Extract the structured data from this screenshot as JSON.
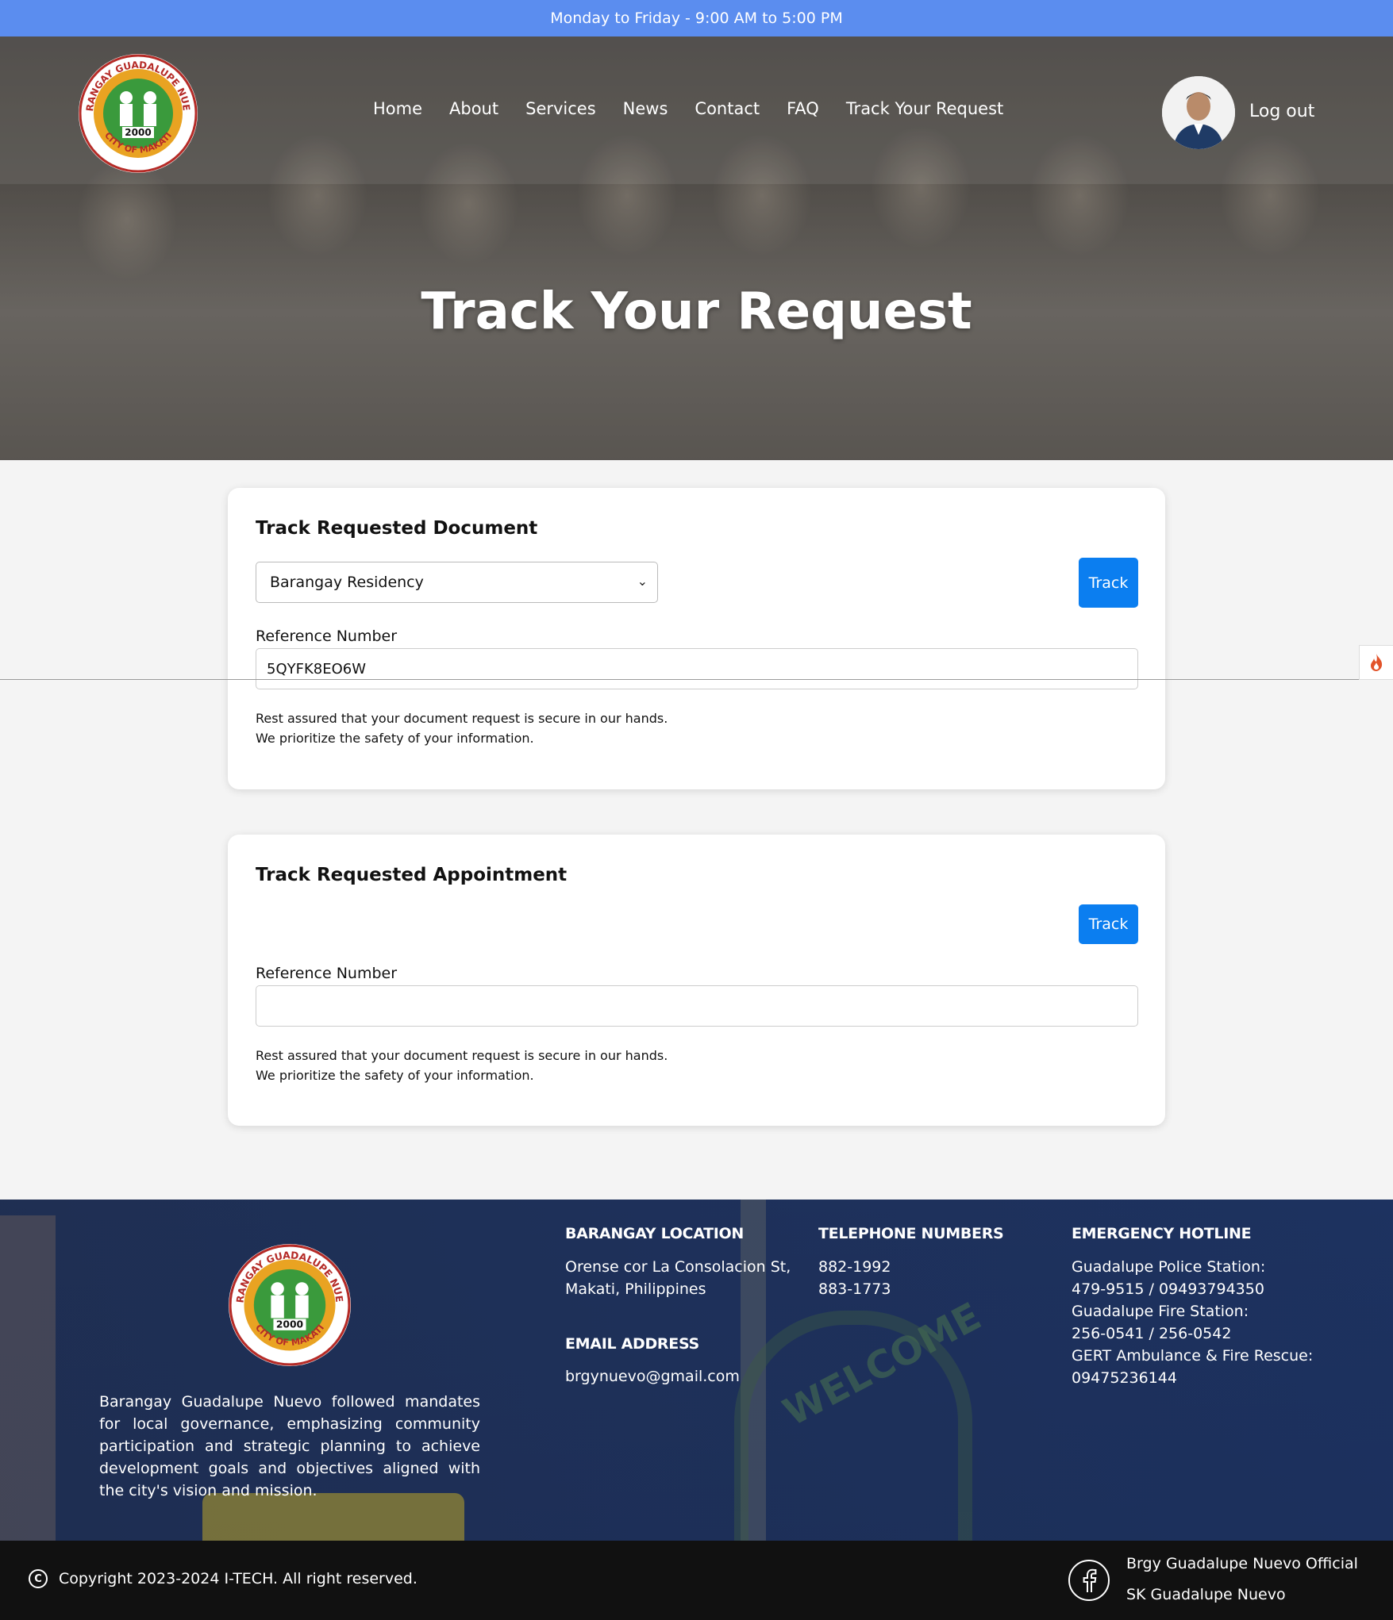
{
  "topbar": {
    "hours": "Monday to Friday - 9:00 AM to 5:00 PM"
  },
  "header": {
    "logo_text": [
      "BARANGAY GUADALUPE NUEVO",
      "CITY OF MAKATI",
      "2000"
    ],
    "nav": [
      "Home",
      "About",
      "Services",
      "News",
      "Contact",
      "FAQ",
      "Track Your Request"
    ],
    "logout": "Log out"
  },
  "hero": {
    "title": "Track Your Request"
  },
  "document_card": {
    "title": "Track Requested Document",
    "select_value": "Barangay Residency",
    "track_label": "Track",
    "ref_label": "Reference Number",
    "ref_value": "5QYFK8EO6W",
    "note_line1": "Rest assured that your document request is secure in our hands.",
    "note_line2": "We prioritize the safety of your information."
  },
  "appointment_card": {
    "title": "Track Requested Appointment",
    "track_label": "Track",
    "ref_label": "Reference Number",
    "ref_value": "",
    "note_line1": "Rest assured that your document request is secure in our hands.",
    "note_line2": "We prioritize the safety of your information."
  },
  "footer": {
    "about": "Barangay Guadalupe Nuevo followed mandates for local governance, emphasizing community participation and strategic planning to achieve development goals and objectives aligned with the city's vision and mission.",
    "location_heading": "BARANGAY LOCATION",
    "location_line1": "Orense cor La Consolacion St,",
    "location_line2": "Makati, Philippines",
    "email_heading": "EMAIL ADDRESS",
    "email": "brgynuevo@gmail.com",
    "phone_heading": "TELEPHONE NUMBERS",
    "phone1": "882-1992",
    "phone2": "883-1773",
    "emergency_heading": "EMERGENCY HOTLINE",
    "emergency": [
      "Guadalupe Police Station:",
      "479-9515 / 09493794350",
      "Guadalupe Fire Station:",
      "256-0541 / 256-0542",
      "GERT Ambulance & Fire Rescue:",
      "09475236144"
    ],
    "sign_text": "WELCOME"
  },
  "bottombar": {
    "copyright": "Copyright 2023-2024 I-TECH. All right reserved.",
    "social1": "Brgy Guadalupe Nuevo Official",
    "social2": "SK Guadalupe Nuevo"
  },
  "colors": {
    "topbar": "#5b8def",
    "button": "#0b7ef0",
    "bottombar": "#111111"
  }
}
